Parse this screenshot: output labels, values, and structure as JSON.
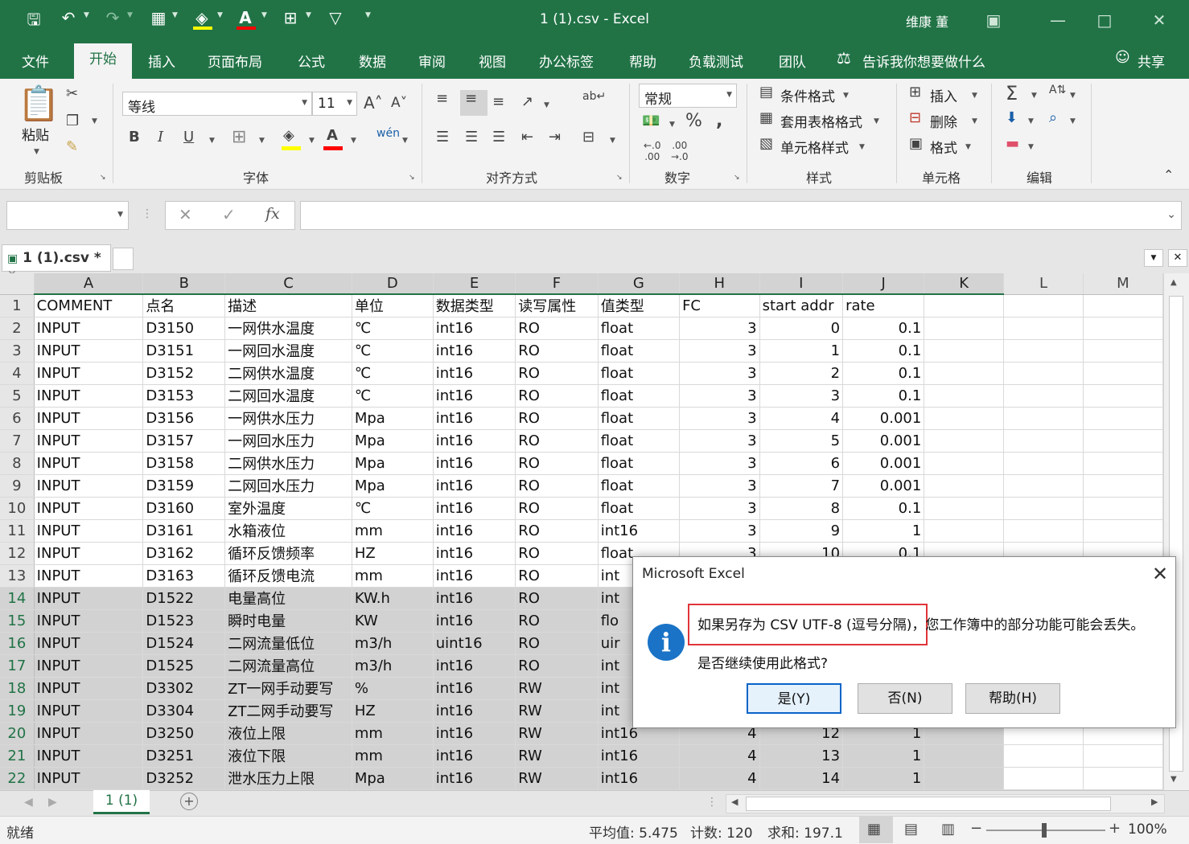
{
  "window": {
    "title": "1 (1).csv  -  Excel",
    "user": "维康 董"
  },
  "ribbon_tabs": [
    "文件",
    "开始",
    "插入",
    "页面布局",
    "公式",
    "数据",
    "审阅",
    "视图",
    "办公标签",
    "帮助",
    "负载测试",
    "团队"
  ],
  "tell_me": "告诉我你想要做什么",
  "share": "共享",
  "ribbon": {
    "paste": "粘贴",
    "font_name": "等线",
    "font_size": "11",
    "number_format": "常规",
    "cond_format": "条件格式",
    "table_format": "套用表格格式",
    "cell_style": "单元格样式",
    "insert": "插入",
    "delete": "删除",
    "format": "格式",
    "groups": {
      "clipboard": "剪贴板",
      "font": "字体",
      "alignment": "对齐方式",
      "number": "数字",
      "styles": "样式",
      "cells": "单元格",
      "editing": "编辑"
    }
  },
  "formula_bar": {
    "name_box": "",
    "formula": ""
  },
  "doc_tab": "1 (1).csv *",
  "columns": [
    "A",
    "B",
    "C",
    "D",
    "E",
    "F",
    "G",
    "H",
    "I",
    "J",
    "K",
    "L",
    "M"
  ],
  "rows": [
    [
      "COMMENT",
      "点名",
      "描述",
      "单位",
      "数据类型",
      "读写属性",
      "值类型",
      "FC",
      "start addr",
      "rate"
    ],
    [
      "INPUT",
      "D3150",
      "一网供水温度",
      "℃",
      "int16",
      "RO",
      "float",
      "3",
      "0",
      "0.1"
    ],
    [
      "INPUT",
      "D3151",
      "一网回水温度",
      "℃",
      "int16",
      "RO",
      "float",
      "3",
      "1",
      "0.1"
    ],
    [
      "INPUT",
      "D3152",
      "二网供水温度",
      "℃",
      "int16",
      "RO",
      "float",
      "3",
      "2",
      "0.1"
    ],
    [
      "INPUT",
      "D3153",
      "二网回水温度",
      "℃",
      "int16",
      "RO",
      "float",
      "3",
      "3",
      "0.1"
    ],
    [
      "INPUT",
      "D3156",
      "一网供水压力",
      "Mpa",
      "int16",
      "RO",
      "float",
      "3",
      "4",
      "0.001"
    ],
    [
      "INPUT",
      "D3157",
      "一网回水压力",
      "Mpa",
      "int16",
      "RO",
      "float",
      "3",
      "5",
      "0.001"
    ],
    [
      "INPUT",
      "D3158",
      "二网供水压力",
      "Mpa",
      "int16",
      "RO",
      "float",
      "3",
      "6",
      "0.001"
    ],
    [
      "INPUT",
      "D3159",
      "二网回水压力",
      "Mpa",
      "int16",
      "RO",
      "float",
      "3",
      "7",
      "0.001"
    ],
    [
      "INPUT",
      "D3160",
      "室外温度",
      "℃",
      "int16",
      "RO",
      "float",
      "3",
      "8",
      "0.1"
    ],
    [
      "INPUT",
      "D3161",
      "水箱液位",
      "mm",
      "int16",
      "RO",
      "int16",
      "3",
      "9",
      "1"
    ],
    [
      "INPUT",
      "D3162",
      "循环反馈频率",
      "HZ",
      "int16",
      "RO",
      "float",
      "3",
      "10",
      "0.1"
    ],
    [
      "INPUT",
      "D3163",
      "循环反馈电流",
      "mm",
      "int16",
      "RO",
      "int",
      "",
      "",
      ""
    ],
    [
      "INPUT",
      "D1522",
      "电量高位",
      "KW.h",
      "int16",
      "RO",
      "int",
      "",
      "",
      ""
    ],
    [
      "INPUT",
      "D1523",
      "瞬时电量",
      "KW",
      "int16",
      "RO",
      "flo",
      "",
      "",
      ""
    ],
    [
      "INPUT",
      "D1524",
      "二网流量低位",
      "m3/h",
      "uint16",
      "RO",
      "uir",
      "",
      "",
      ""
    ],
    [
      "INPUT",
      "D1525",
      "二网流量高位",
      "m3/h",
      "int16",
      "RO",
      "int",
      "",
      "",
      ""
    ],
    [
      "INPUT",
      "D3302",
      "ZT一网手动要写",
      "%",
      "int16",
      "RW",
      "int",
      "",
      "",
      ""
    ],
    [
      "INPUT",
      "D3304",
      "ZT二网手动要写",
      "HZ",
      "int16",
      "RW",
      "int",
      "",
      "",
      ""
    ],
    [
      "INPUT",
      "D3250",
      "液位上限",
      "mm",
      "int16",
      "RW",
      "int16",
      "4",
      "12",
      "1"
    ],
    [
      "INPUT",
      "D3251",
      "液位下限",
      "mm",
      "int16",
      "RW",
      "int16",
      "4",
      "13",
      "1"
    ],
    [
      "INPUT",
      "D3252",
      "泄水压力上限",
      "Mpa",
      "int16",
      "RW",
      "int16",
      "4",
      "14",
      "1"
    ]
  ],
  "sheet_tab": "1 (1)",
  "status": {
    "ready": "就绪",
    "average": "平均值: 5.475",
    "count": "计数: 120",
    "sum": "求和: 197.1",
    "zoom": "100%"
  },
  "dialog": {
    "title": "Microsoft Excel",
    "message_highlight": "如果另存为 CSV UTF-8 (逗号分隔)，",
    "message_rest": "您工作簿中的部分功能可能会丢失。",
    "question": "是否继续使用此格式?",
    "yes": "是(Y)",
    "no": "否(N)",
    "help": "帮助(H)"
  },
  "colors": {
    "excel_green": "#217346",
    "highlight_red": "#e0353a",
    "info_blue": "#1a73c6"
  }
}
